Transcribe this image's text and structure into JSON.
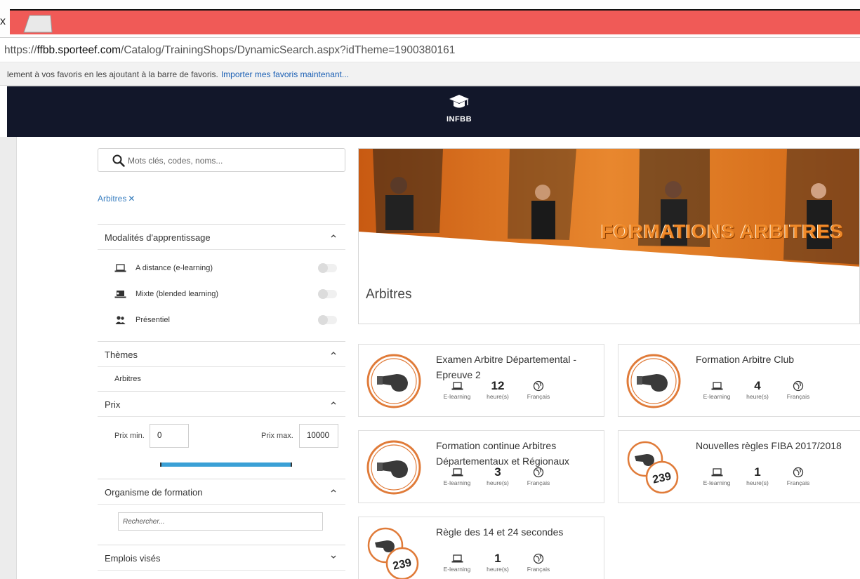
{
  "browser": {
    "close_glyph": "x",
    "url_scheme": "https://",
    "url_host": "ffbb.sporteef.com",
    "url_path": "/Catalog/TrainingShops/DynamicSearch.aspx?idTheme=1900380161",
    "favbar_text": "lement à vos favoris en les ajoutant à la barre de favoris.",
    "favbar_link": "Importer mes favoris maintenant..."
  },
  "header": {
    "logo_text": "INFBB"
  },
  "sidebar": {
    "search_placeholder": "Mots clés, codes, noms...",
    "active_filter": "Arbitres",
    "active_filter_remove": "✕",
    "modalities": {
      "title": "Modalités d'apprentissage",
      "options": [
        {
          "label": "A distance (e-learning)",
          "icon": "laptop-icon"
        },
        {
          "label": "Mixte (blended learning)",
          "icon": "blended-icon"
        },
        {
          "label": "Présentiel",
          "icon": "people-icon"
        }
      ]
    },
    "themes": {
      "title": "Thèmes",
      "items": [
        "Arbitres"
      ]
    },
    "price": {
      "title": "Prix",
      "min_label": "Prix min.",
      "min_value": "0",
      "max_label": "Prix max.",
      "max_value": "10000",
      "range": [
        0,
        1
      ]
    },
    "organisme": {
      "title": "Organisme de formation",
      "search_placeholder": "Rechercher..."
    },
    "emplois": {
      "title": "Emplois visés"
    }
  },
  "banner": {
    "title_big": "FORMATIONS ARBITRES",
    "caption": "Arbitres"
  },
  "meta_labels": {
    "mode": "E-learning",
    "hours": "heure(s)",
    "lang": "Français"
  },
  "cards": [
    {
      "title": "Examen Arbitre Départemental - Epreuve 2",
      "hours": "12",
      "avatar": "whistle-icon"
    },
    {
      "title": "Formation Arbitre Club",
      "hours": "4",
      "avatar": "whistle-icon"
    },
    {
      "title": "Formation continue Arbitres Départementaux et Régionaux",
      "hours": "3",
      "avatar": "whistle-icon"
    },
    {
      "title": "Nouvelles règles FIBA 2017/2018",
      "hours": "1",
      "avatar": "whistle-rules-icon",
      "badge": "239"
    },
    {
      "title": "Règle des 14 et 24 secondes",
      "hours": "1",
      "avatar": "whistle-rules-icon",
      "badge": "239"
    }
  ],
  "colors": {
    "header_bg": "#12172a",
    "tab_bg": "#f05a57",
    "accent_orange": "#e07b39",
    "link_blue": "#3a7fc1",
    "slider_blue": "#3aa0d6"
  }
}
